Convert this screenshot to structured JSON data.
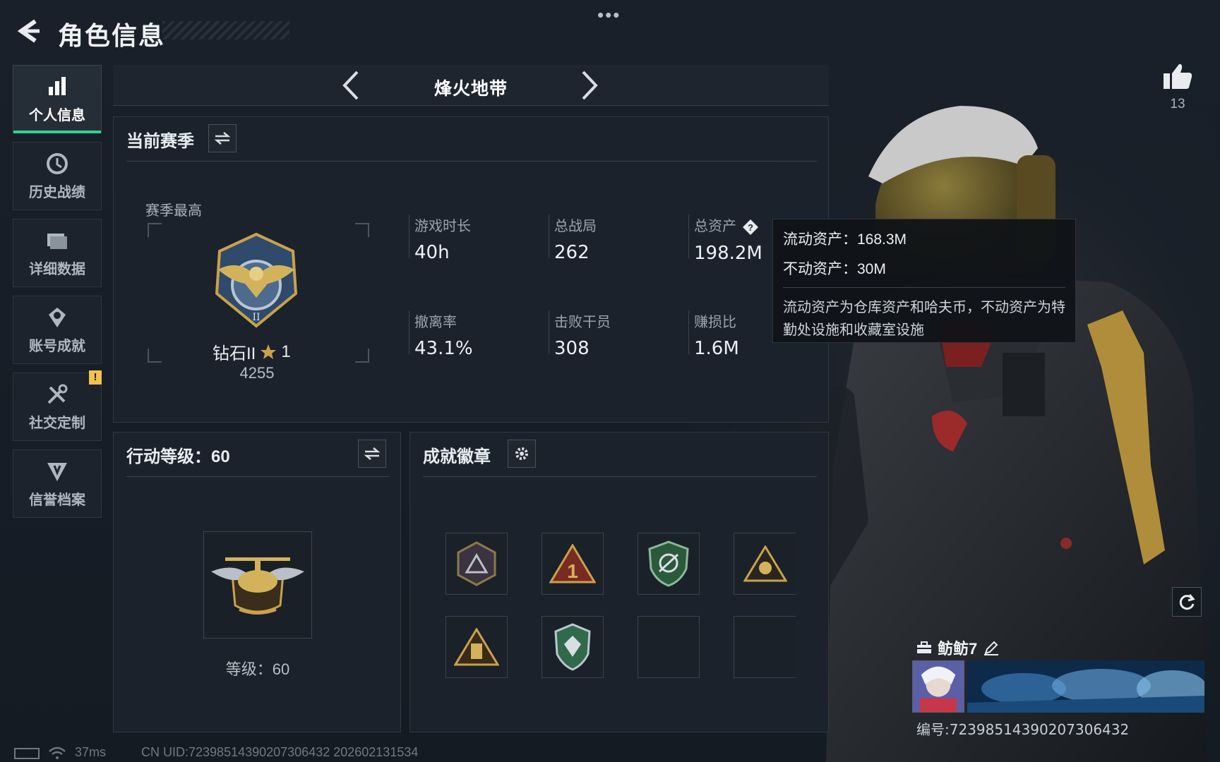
{
  "header": {
    "title": "角色信息",
    "more_icon": "more-dots-icon",
    "back_icon": "back-arrow-icon"
  },
  "like": {
    "count": "13",
    "icon": "thumbs-up-icon"
  },
  "sidebar": {
    "items": [
      {
        "label": "个人信息",
        "icon": "bar-chart-icon",
        "active": true
      },
      {
        "label": "历史战绩",
        "icon": "history-clock-icon"
      },
      {
        "label": "详细数据",
        "icon": "folder-icon"
      },
      {
        "label": "账号成就",
        "icon": "achievement-icon"
      },
      {
        "label": "社交定制",
        "icon": "tools-icon",
        "badge": "!"
      },
      {
        "label": "信誉档案",
        "icon": "shield-icon"
      }
    ]
  },
  "mode": {
    "title": "烽火地带",
    "prev_icon": "chevron-left-icon",
    "next_icon": "chevron-right-icon"
  },
  "season": {
    "title": "当前赛季",
    "switch_icon": "swap-icon",
    "best_label": "赛季最高",
    "rank_name": "钻石II",
    "rank_stars": "1",
    "rank_score": "4255",
    "stats": [
      {
        "label": "游戏时长",
        "value": "40h"
      },
      {
        "label": "总战局",
        "value": "262"
      },
      {
        "label": "总资产",
        "value": "198.2M",
        "help": "?"
      },
      {
        "label": "撤离率",
        "value": "43.1%"
      },
      {
        "label": "击败干员",
        "value": "308"
      },
      {
        "label": "赚损比",
        "value": "1.6M"
      }
    ]
  },
  "tooltip": {
    "liquid": "流动资产：168.3M",
    "fixed": "不动资产：30M",
    "desc": "流动资产为仓库资产和哈夫币，不动资产为特勤处设施和收藏室设施"
  },
  "level": {
    "title": "行动等级：60",
    "level_text": "等级：60"
  },
  "badges": {
    "title": "成就徽章",
    "settings_icon": "gear-icon"
  },
  "player": {
    "name": "鲂鲂7",
    "id_text": "编号:7239851439020730643​2"
  },
  "status": {
    "ping": "37ms",
    "uid": "CN UID:7239851439020730643​2  202602131534"
  },
  "colors": {
    "accent": "#35d18a",
    "warning": "#f2c14e",
    "gold": "#c9a24a"
  }
}
